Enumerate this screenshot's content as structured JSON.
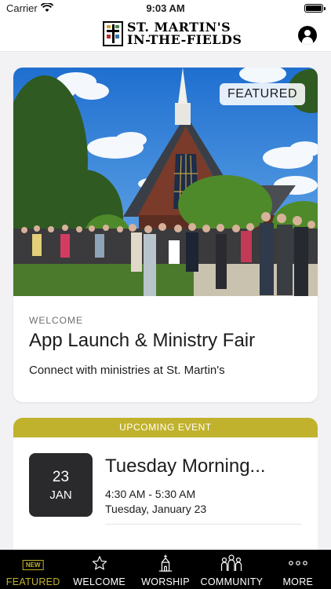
{
  "status_bar": {
    "carrier": "Carrier",
    "time": "9:03 AM"
  },
  "header": {
    "logo_line1": "ST. MARTIN'S",
    "logo_line2": "IN-THE-FIELDS",
    "profile_icon": "person-circle-icon"
  },
  "featured_card": {
    "badge": "FEATURED",
    "eyebrow": "WELCOME",
    "title": "App Launch & Ministry Fair",
    "description": "Connect with ministries at St. Martin's"
  },
  "event_card": {
    "banner": "UPCOMING EVENT",
    "date_day": "23",
    "date_month": "JAN",
    "title": "Tuesday Morning...",
    "time_range": "4:30 AM - 5:30 AM",
    "full_date": "Tuesday, January 23"
  },
  "tab_bar": {
    "tabs": [
      {
        "label": "FEATURED",
        "icon": "new-badge-icon",
        "badge_text": "NEW",
        "active": true
      },
      {
        "label": "WELCOME",
        "icon": "star-icon"
      },
      {
        "label": "WORSHIP",
        "icon": "church-icon"
      },
      {
        "label": "COMMUNITY",
        "icon": "people-icon"
      },
      {
        "label": "MORE",
        "icon": "ellipsis-icon"
      }
    ]
  },
  "colors": {
    "accent": "#c1b22e",
    "tab_bar_bg": "#000000",
    "date_box_bg": "#2a2a2d"
  }
}
